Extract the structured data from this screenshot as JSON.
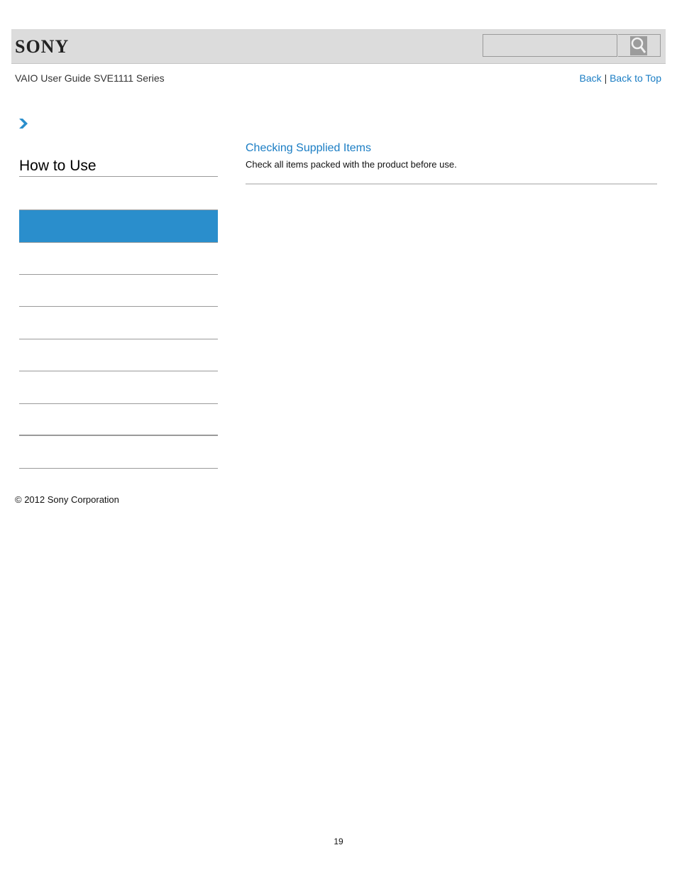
{
  "header": {
    "logo": "SONY",
    "search": {
      "placeholder": "",
      "value": "",
      "button_icon": "search-icon"
    }
  },
  "subheader": {
    "title": "VAIO User Guide SVE1111 Series",
    "links": {
      "back": "Back",
      "separator": "|",
      "back_to_top": "Back to Top"
    }
  },
  "breadcrumb": {
    "icon": "chevron-right-icon"
  },
  "sidebar": {
    "title": "How to Use",
    "active_item_color": "#2a8ecc",
    "items": [
      "",
      "",
      "",
      "",
      "",
      "",
      "",
      ""
    ]
  },
  "main": {
    "topics": [
      {
        "title": "Checking Supplied Items",
        "description": "Check all items packed with the product before use."
      }
    ]
  },
  "footer": {
    "copyright": "© 2012 Sony Corporation"
  },
  "page_number": "19",
  "colors": {
    "link": "#1a7dc4",
    "accent": "#2a8ecc",
    "header_bg": "#dcdcdc"
  }
}
